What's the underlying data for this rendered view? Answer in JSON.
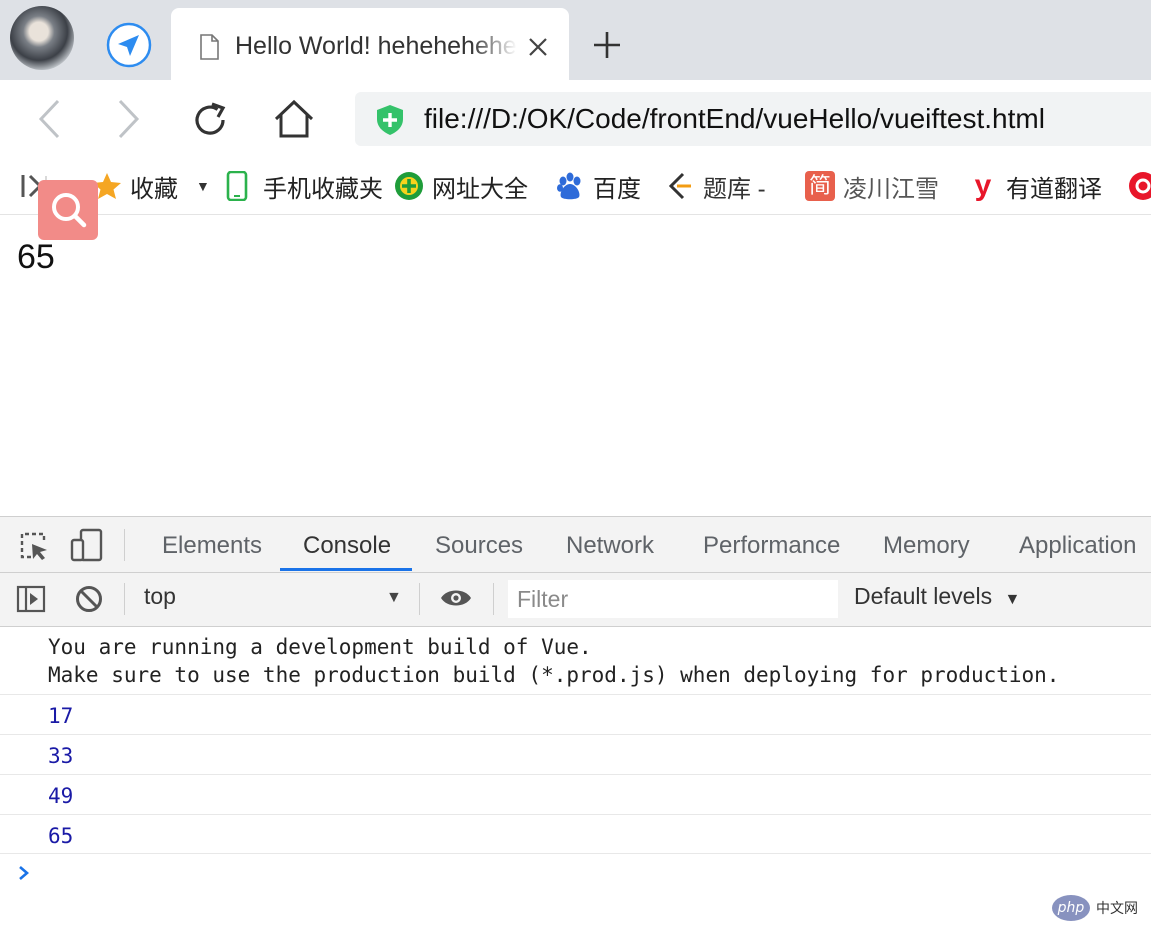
{
  "browser": {
    "tab": {
      "title": "Hello World! hehehehehe"
    },
    "address": {
      "url": "file:///D:/OK/Code/frontEnd/vueHello/vueiftest.html"
    },
    "bookmarks": [
      {
        "label": "收藏",
        "icon": "star-icon"
      },
      {
        "label": "手机收藏夹",
        "icon": "phone-icon"
      },
      {
        "label": "网址大全",
        "icon": "plus-globe-icon"
      },
      {
        "label": "百度",
        "icon": "baidu-paw-icon"
      },
      {
        "label": "题库 -",
        "icon": "tiku-icon"
      },
      {
        "label": "凌川江雪",
        "icon": "jian-icon"
      },
      {
        "label": "有道翻译",
        "icon": "youdao-icon"
      }
    ]
  },
  "page": {
    "value": "65"
  },
  "devtools": {
    "tabs": [
      "Elements",
      "Console",
      "Sources",
      "Network",
      "Performance",
      "Memory",
      "Application"
    ],
    "active_tab": "Console",
    "console": {
      "context": "top",
      "filter_placeholder": "Filter",
      "levels": "Default levels",
      "messages": [
        {
          "line1": "You are running a development build of Vue.",
          "line2": "Make sure to use the production build (*.prod.js) when deploying for production."
        },
        {
          "value": "17"
        },
        {
          "value": "33"
        },
        {
          "value": "49"
        },
        {
          "value": "65"
        }
      ]
    }
  },
  "watermark": {
    "badge": "php",
    "text": "中文网"
  },
  "colors": {
    "accent": "#1a73e8",
    "shield": "#34c26a",
    "console_number": "#1a1aa6"
  }
}
